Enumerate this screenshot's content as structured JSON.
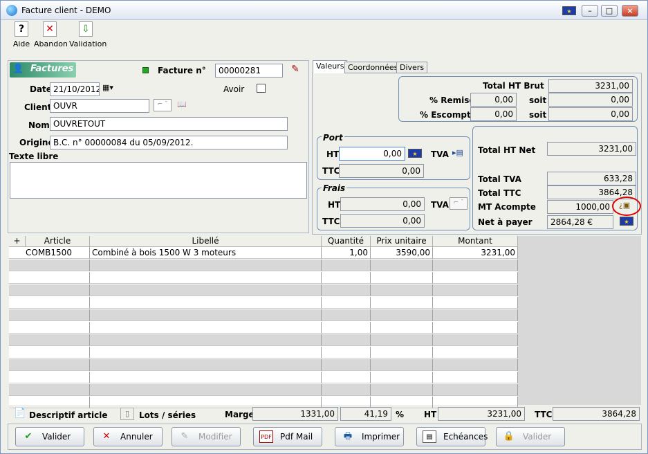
{
  "window": {
    "title": "Facture client - DEMO"
  },
  "toolbar": {
    "aide": "Aide",
    "abandon": "Abandon",
    "validation": "Validation"
  },
  "header": {
    "banner": "Factures",
    "facture_label": "Facture n°",
    "facture_value": "00000281",
    "date_label": "Date",
    "date_value": "21/10/2012",
    "avoir_label": "Avoir",
    "client_label": "Client",
    "client_value": "OUVR",
    "nom_label": "Nom",
    "nom_value": "OUVRETOUT",
    "origine_label": "Origine",
    "origine_value": "B.C. n° 00000084 du 05/09/2012.",
    "texte_libre_label": "Texte libre",
    "texte_libre_value": ""
  },
  "tabs": [
    "Valeurs",
    "Coordonnées",
    "Divers"
  ],
  "valeurs": {
    "total_ht_brut_label": "Total HT Brut",
    "total_ht_brut": "3231,00",
    "remise_label": "% Remise",
    "remise_pct": "0,00",
    "remise_soit_label": "soit",
    "remise_soit": "0,00",
    "escompte_label": "% Escompte",
    "escompte_pct": "0,00",
    "escompte_soit_label": "soit",
    "escompte_soit": "0,00",
    "port_label": "Port",
    "port_ht_label": "HT",
    "port_ht": "0,00",
    "port_tva_label": "TVA",
    "port_ttc_label": "TTC",
    "port_ttc": "0,00",
    "frais_label": "Frais",
    "frais_ht_label": "HT",
    "frais_ht": "0,00",
    "frais_tva_label": "TVA",
    "frais_ttc_label": "TTC",
    "frais_ttc": "0,00",
    "total_ht_net_label": "Total HT Net",
    "total_ht_net": "3231,00",
    "total_tva_label": "Total TVA",
    "total_tva": "633,28",
    "total_ttc_label": "Total TTC",
    "total_ttc": "3864,28",
    "mt_acompte_label": "MT Acompte",
    "mt_acompte": "1000,00",
    "net_a_payer_label": "Net à payer",
    "net_a_payer": "2864,28 €"
  },
  "grid": {
    "add_symbol": "+",
    "columns": [
      "Article",
      "Libellé",
      "Quantité",
      "Prix unitaire",
      "Montant"
    ],
    "rows": [
      {
        "article": "COMB1500",
        "libelle": "Combiné à bois 1500 W 3 moteurs",
        "quantite": "1,00",
        "prix": "3590,00",
        "montant": "3231,00"
      }
    ]
  },
  "footer": {
    "descriptif_label": "Descriptif article",
    "lots_label": "Lots / séries",
    "marge_label": "Marge",
    "marge_value": "1331,00",
    "marge_pct": "41,19",
    "pct_symbol": "%",
    "ht_label": "HT",
    "ht_value": "3231,00",
    "ttc_label": "TTC",
    "ttc_value": "3864,28"
  },
  "buttons": {
    "valider": "Valider",
    "annuler": "Annuler",
    "modifier": "Modifier",
    "pdf_mail": "Pdf Mail",
    "imprimer": "Imprimer",
    "echeances": "Echéances",
    "valider2": "Valider"
  },
  "icons": {
    "app": "globe-icon",
    "euro_flag": "eu-flag-icon",
    "calendar": "calendar-icon",
    "book": "book-icon",
    "pen": "pen-icon",
    "acompte": "coin-icon"
  },
  "colors": {
    "accent": "#1e3ca8",
    "status_green": "#22aa22",
    "highlight_circle": "#dd0000"
  }
}
